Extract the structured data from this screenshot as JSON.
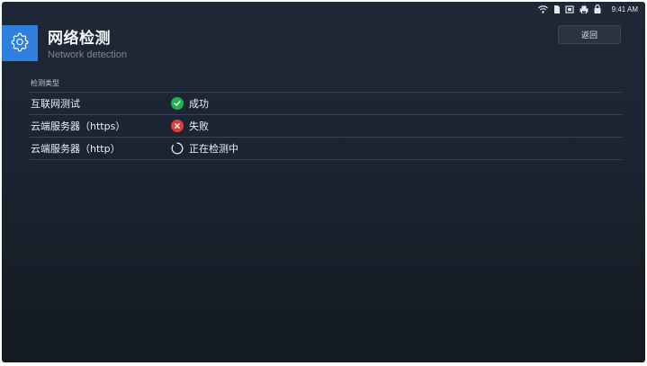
{
  "status_bar": {
    "time": "9:41 AM",
    "icons": [
      "wifi-icon",
      "sim-icon",
      "battery-saver-icon",
      "printer-icon",
      "lock-icon"
    ]
  },
  "header": {
    "icon": "gear-icon",
    "title": "网络检测",
    "subtitle": "Network detection",
    "back_label": "返回"
  },
  "table": {
    "section_label": "检测类型",
    "rows": [
      {
        "name": "互联网测试",
        "status": "success",
        "status_label": "成功",
        "icon": "check-icon"
      },
      {
        "name": "云端服务器（https）",
        "status": "failed",
        "status_label": "失败",
        "icon": "close-icon"
      },
      {
        "name": "云端服务器（http）",
        "status": "checking",
        "status_label": "正在检测中",
        "icon": "loading-spinner-icon"
      }
    ]
  },
  "colors": {
    "accent": "#2f7fe0",
    "success": "#22b14c",
    "error": "#e23b3b",
    "background": "#1b2431"
  }
}
